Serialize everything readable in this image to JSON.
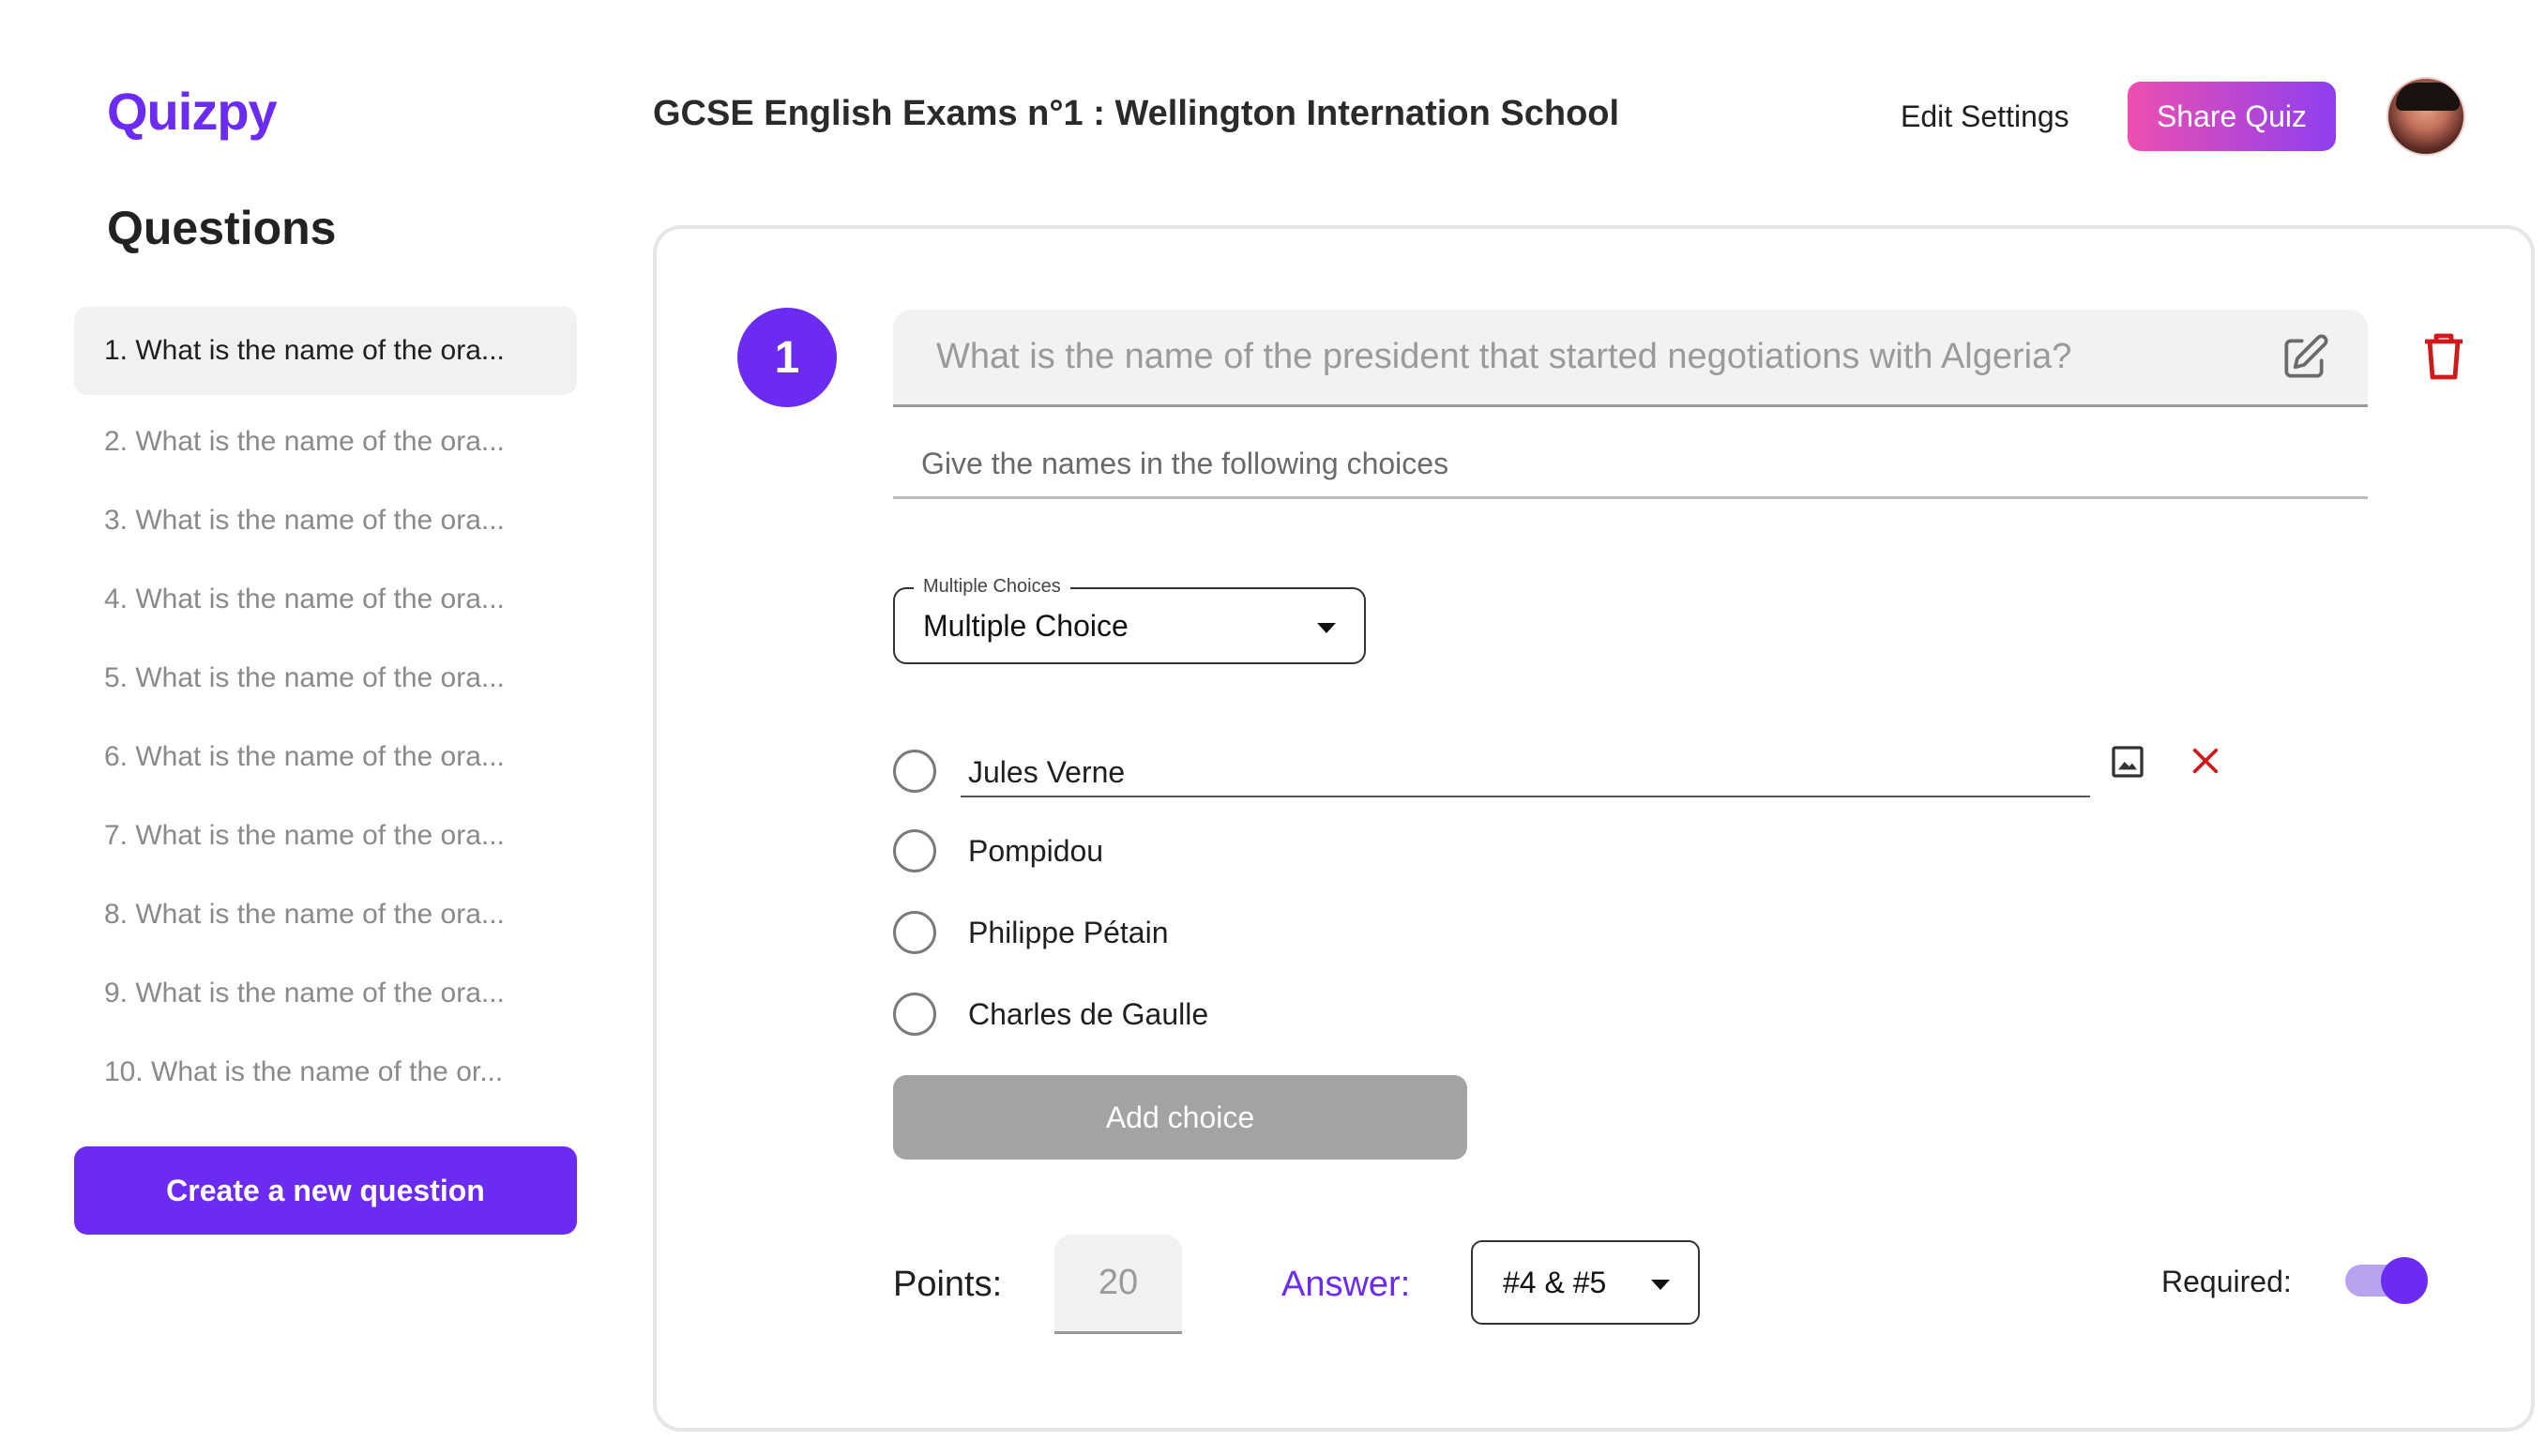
{
  "header": {
    "logo": "Quizpy",
    "title": "GCSE English Exams n°1 : Wellington Internation School",
    "edit_settings": "Edit Settings",
    "share_quiz": "Share Quiz",
    "avatar_icon": "user-avatar"
  },
  "sidebar": {
    "title": "Questions",
    "questions": [
      "1. What is the name of the ora...",
      "2. What is the name of the ora...",
      "3. What is the name of the ora...",
      "4. What is the name of the ora...",
      "5. What is the name of the ora...",
      "6. What is the name of the ora...",
      "7. What is the name of the ora...",
      "8. What is the name of the ora...",
      "9. What is the name of the ora...",
      "10. What is the name of the or..."
    ],
    "active_index": 0,
    "create_button": "Create a new question"
  },
  "editor": {
    "number": "1",
    "question": "What is the name of the president that started negotiations with Algeria?",
    "description": "Give the names in the following choices",
    "type_legend": "Multiple Choices",
    "type_value": "Multiple Choice",
    "choices": [
      "Jules Verne",
      "Pompidou",
      "Philippe Pétain",
      "Charles de Gaulle"
    ],
    "add_choice": "Add choice",
    "points_label": "Points:",
    "points_value": "20",
    "answer_label": "Answer:",
    "answer_value": "#4 & #5",
    "required_label": "Required:",
    "required": true
  },
  "colors": {
    "accent": "#6c2bf2",
    "share_gradient_start": "#ec4fb0",
    "share_gradient_end": "#8f3ff0",
    "delete": "#d0191b",
    "disabled_button": "#a3a3a3"
  },
  "icons": [
    "edit-icon",
    "trash-icon",
    "image-icon",
    "close-icon",
    "chevron-down-icon"
  ]
}
